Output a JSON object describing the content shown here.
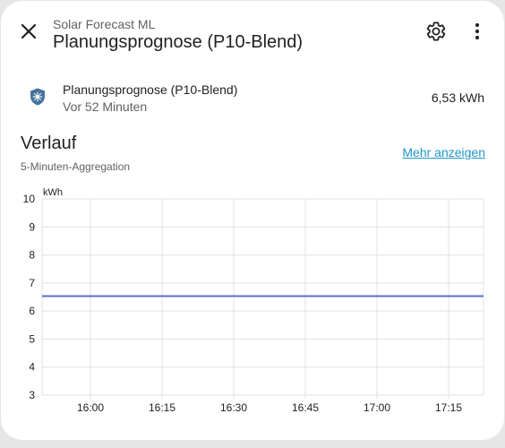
{
  "header": {
    "subtitle": "Solar Forecast ML",
    "title": "Planungsprognose (P10-Blend)",
    "close_icon": "close-icon",
    "settings_icon": "gear-icon",
    "menu_icon": "more-vert-icon"
  },
  "entity": {
    "icon": "shield-sun-icon",
    "name": "Planungsprognose (P10-Blend)",
    "last_changed": "Vor 52 Minuten",
    "state": "6,53 kWh"
  },
  "history": {
    "title": "Verlauf",
    "subtitle": "5-Minuten-Aggregation",
    "more_link": "Mehr anzeigen"
  },
  "colors": {
    "accent": "#2196c9",
    "line": "#5a6fd6",
    "grid": "#e0e0e0",
    "icon_blue": "#44739e"
  },
  "chart_data": {
    "type": "line",
    "ylabel": "kWh",
    "ylim": [
      3,
      10
    ],
    "yticks": [
      "10",
      "9",
      "8",
      "7",
      "6",
      "5",
      "4",
      "3"
    ],
    "xticks": [
      "16:00",
      "16:15",
      "16:30",
      "16:45",
      "17:00",
      "17:15"
    ],
    "grid": true,
    "series": [
      {
        "values": [
          6.53,
          6.53
        ]
      }
    ]
  }
}
